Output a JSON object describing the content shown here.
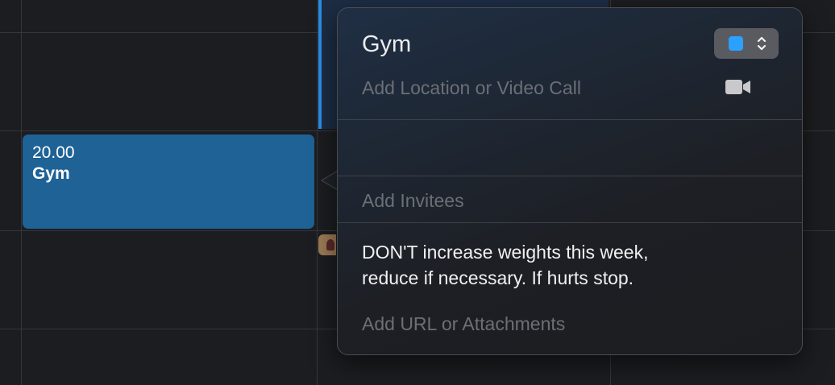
{
  "event": {
    "time": "20.00",
    "title": "Gym"
  },
  "popover": {
    "title": "Gym",
    "location_placeholder": "Add Location or Video Call",
    "invitees_placeholder": "Add Invitees",
    "notes": "DON'T increase weights this week,\nreduce if necessary. If hurts stop.",
    "url_placeholder": "Add URL or Attachments",
    "calendar_color": "#2aa0ff"
  },
  "icons": {
    "video": "video-camera-icon",
    "chevrons": "up-down-chevron-icon"
  },
  "colors": {
    "background": "#1c1d20",
    "event_fill": "#1e6296",
    "event_accent": "#2b8ee8"
  }
}
